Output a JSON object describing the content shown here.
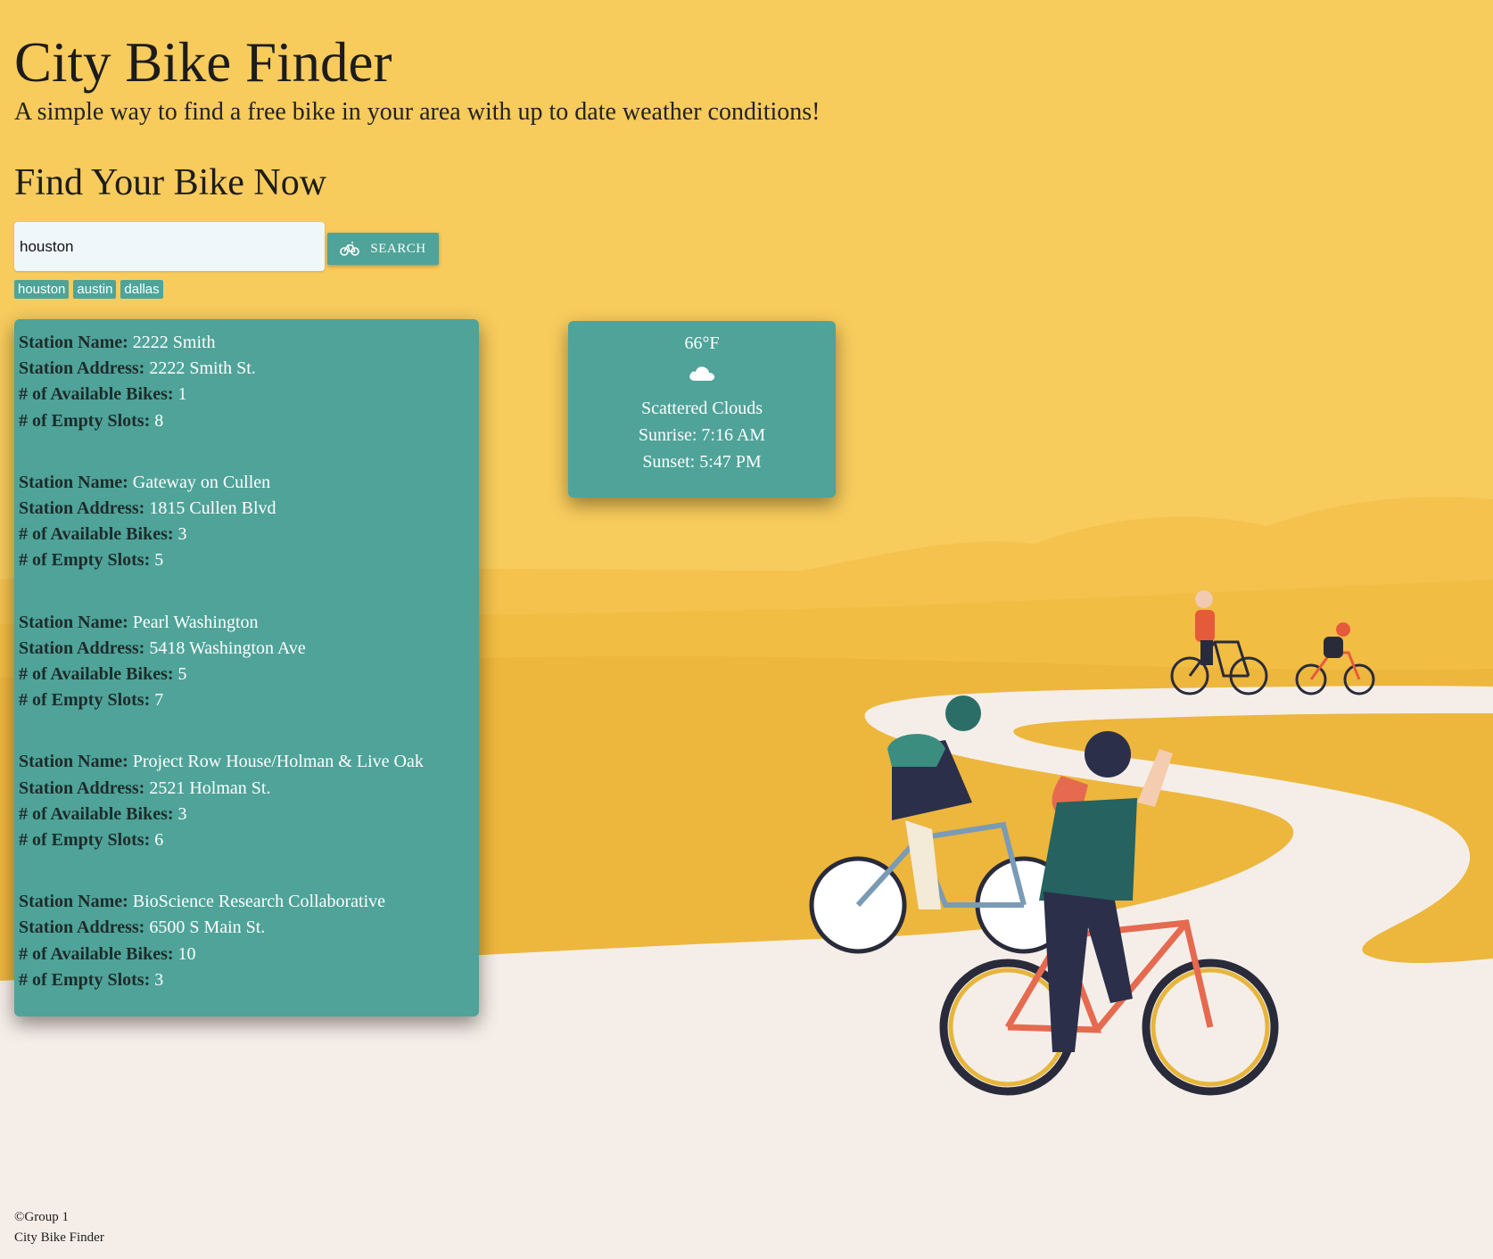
{
  "header": {
    "title": "City Bike Finder",
    "subtitle": "A simple way to find a free bike in your area with up to date weather conditions!"
  },
  "search": {
    "heading": "Find Your Bike Now",
    "value": "houston",
    "button_label": "SEARCH",
    "button_icon": "bike-icon",
    "history": [
      "houston",
      "austin",
      "dallas"
    ]
  },
  "stations": {
    "labels": {
      "name": "Station Name:",
      "address": "Station Address:",
      "bikes": "# of Available Bikes:",
      "slots": "# of Empty Slots:"
    },
    "items": [
      {
        "name": "2222 Smith",
        "address": "2222 Smith St.",
        "bikes": "1",
        "slots": "8"
      },
      {
        "name": "Gateway on Cullen",
        "address": "1815 Cullen Blvd",
        "bikes": "3",
        "slots": "5"
      },
      {
        "name": "Pearl Washington",
        "address": "5418 Washington Ave",
        "bikes": "5",
        "slots": "7"
      },
      {
        "name": "Project Row House/Holman & Live Oak",
        "address": "2521 Holman St.",
        "bikes": "3",
        "slots": "6"
      },
      {
        "name": "BioScience Research Collaborative",
        "address": "6500 S Main St.",
        "bikes": "10",
        "slots": "3"
      }
    ]
  },
  "weather": {
    "temperature": "66°F",
    "icon": "cloud-icon",
    "description": "Scattered Clouds",
    "sunrise": "Sunrise: 7:16 AM",
    "sunset": "Sunset: 5:47 PM"
  },
  "footer": {
    "copyright": "©Group 1",
    "name": "City Bike Finder"
  },
  "colors": {
    "background": "#f7cb5c",
    "accent": "#4fa399",
    "path": "#f5eee8"
  }
}
